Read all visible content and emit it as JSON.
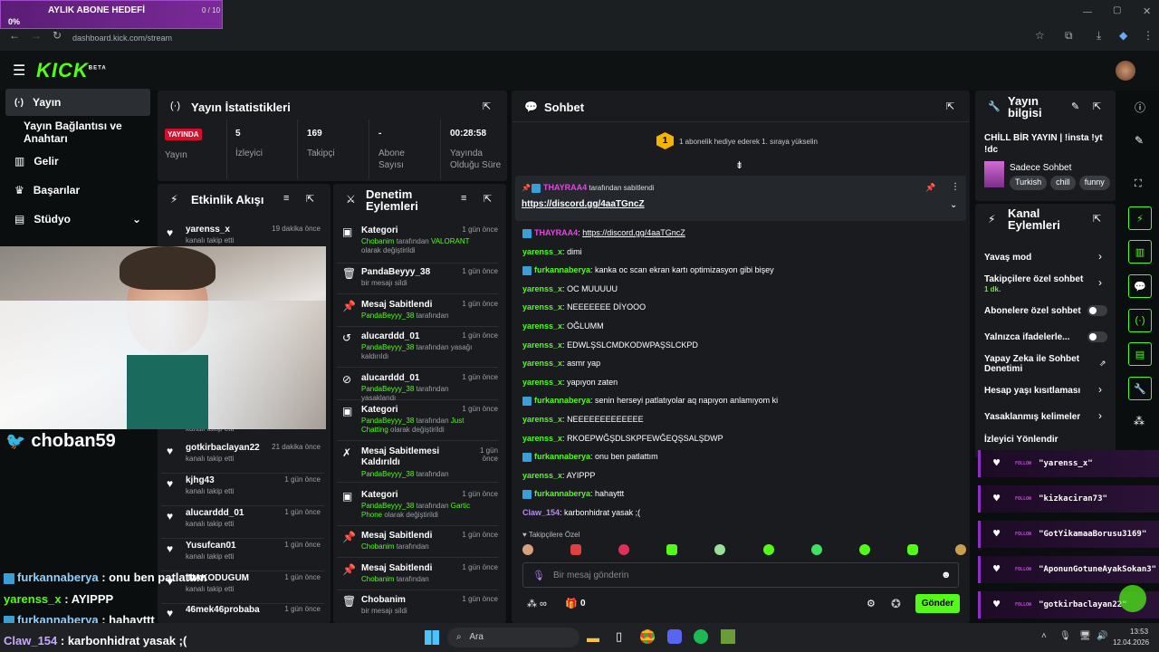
{
  "browser": {
    "url": "dashboard.kick.com/stream"
  },
  "goal": {
    "title": "AYLIK ABONE HEDEFİ",
    "count": "0 / 10",
    "percent": "0%"
  },
  "brand": {
    "logo": "KICK",
    "beta": "BETA"
  },
  "sidebar": {
    "items": [
      {
        "label": "Yayın",
        "icon": "broadcast-icon"
      },
      {
        "label": "Yayın Bağlantısı ve Anahtarı"
      },
      {
        "label": "Gelir",
        "icon": "chart-icon"
      },
      {
        "label": "Başarılar",
        "icon": "trophy-icon"
      },
      {
        "label": "Stüdyo",
        "icon": "studio-icon"
      }
    ]
  },
  "stats": {
    "title": "Yayın İstatistikleri",
    "live_badge": "YAYINDA",
    "live_label": "Yayın",
    "items": [
      {
        "value": "5",
        "label": "İzleyici"
      },
      {
        "value": "169",
        "label": "Takipçi"
      },
      {
        "value": "-",
        "label": "Abone Sayısı"
      },
      {
        "value": "00:28:58",
        "label": "Yayında Olduğu Süre"
      }
    ]
  },
  "activity": {
    "title": "Etkinlik Akışı",
    "items": [
      {
        "name": "yarenss_x",
        "time": "19 dakika önce",
        "sub": "kanalı takip etti"
      },
      {
        "name": "gotkirbaclayan22",
        "time": "21 dakika önce",
        "sub": "kanalı takip etti"
      },
      {
        "name": "kjhg43",
        "time": "1 gün önce",
        "sub": "kanalı takip etti"
      },
      {
        "name": "alucarddd_01",
        "time": "1 gün önce",
        "sub": "kanalı takip etti"
      },
      {
        "name": "Yusufcan01",
        "time": "1 gün önce",
        "sub": "kanalı takip etti"
      },
      {
        "name": "INAKODUGUM",
        "time": "1 gün önce",
        "sub": "kanalı takip etti"
      },
      {
        "name": "46mek46probaba",
        "time": "1 gün önce",
        "sub": ""
      }
    ],
    "partial_sub": "kanalı takip etti"
  },
  "mod": {
    "title": "Denetim Eylemleri",
    "items": [
      {
        "name": "Kategori",
        "time": "1 gün önce",
        "actor": "Chobanim",
        "mid": " tarafından ",
        "target": "VALORANT",
        "tail": " olarak değiştirildi"
      },
      {
        "name": "PandaBeyyy_38",
        "time": "1 gün önce",
        "actor": "",
        "mid": "bir mesajı sildi",
        "target": "",
        "tail": ""
      },
      {
        "name": "Mesaj Sabitlendi",
        "time": "1 gün önce",
        "actor": "PandaBeyyy_38",
        "mid": " tarafından",
        "target": "",
        "tail": ""
      },
      {
        "name": "alucarddd_01",
        "time": "1 gün önce",
        "actor": "PandaBeyyy_38",
        "mid": " tarafından yasağı kaldırıldı",
        "target": "",
        "tail": ""
      },
      {
        "name": "alucarddd_01",
        "time": "1 gün önce",
        "actor": "PandaBeyyy_38",
        "mid": " tarafından yasaklandı",
        "target": "",
        "tail": ""
      },
      {
        "name": "Kategori",
        "time": "1 gün önce",
        "actor": "PandaBeyyy_38",
        "mid": " tarafından ",
        "target": "Just Chatting",
        "tail": " olarak değiştirildi"
      },
      {
        "name": "Mesaj Sabitlemesi Kaldırıldı",
        "time": "1 gün önce",
        "actor": "PandaBeyyy_38",
        "mid": " tarafından",
        "target": "",
        "tail": ""
      },
      {
        "name": "Kategori",
        "time": "1 gün önce",
        "actor": "PandaBeyyy_38",
        "mid": " tarafından ",
        "target": "Gartic Phone",
        "tail": " olarak değiştirildi"
      },
      {
        "name": "Mesaj Sabitlendi",
        "time": "1 gün önce",
        "actor": "Chobanim",
        "mid": " tarafından",
        "target": "",
        "tail": ""
      },
      {
        "name": "Mesaj Sabitlendi",
        "time": "1 gün önce",
        "actor": "Chobanim",
        "mid": " tarafından",
        "target": "",
        "tail": ""
      },
      {
        "name": "Chobanim",
        "time": "1 gün önce",
        "actor": "",
        "mid": "bir mesajı sildi",
        "target": "",
        "tail": ""
      }
    ]
  },
  "chat": {
    "title": "Sohbet",
    "gift_num": "1",
    "gift_text": "1 abonelik hediye ederek 1. sıraya yükselin",
    "pinned_by": "THAYRAA4",
    "pinned_suffix": " tarafından sabitlendi",
    "pinned_link": "https://discord.gg/4aaTGncZ",
    "messages": [
      {
        "user": "THAYRAA4",
        "color": "#e04ae0",
        "badge": true,
        "text": "https://discord.gg/4aaTGncZ",
        "link": true
      },
      {
        "user": "yarenss_x",
        "color": "#53fc18",
        "badge": false,
        "text": "dimi"
      },
      {
        "user": "furkannaberya",
        "color": "#53fc18",
        "badge": true,
        "text": "kanka oc scan ekran kartı optimizasyon gibi bişey"
      },
      {
        "user": "yarenss_x",
        "color": "#53fc18",
        "badge": false,
        "text": "OC MUUUUU"
      },
      {
        "user": "yarenss_x",
        "color": "#53fc18",
        "badge": false,
        "text": "NEEEEEEE DİYOOO"
      },
      {
        "user": "yarenss_x",
        "color": "#53fc18",
        "badge": false,
        "text": "OĞLUMM"
      },
      {
        "user": "yarenss_x",
        "color": "#53fc18",
        "badge": false,
        "text": "EDWLŞSLCMDKODWPAŞSLCKPD"
      },
      {
        "user": "yarenss_x",
        "color": "#53fc18",
        "badge": false,
        "text": "asmr yap"
      },
      {
        "user": "yarenss_x",
        "color": "#53fc18",
        "badge": false,
        "text": "yapıyon zaten"
      },
      {
        "user": "furkannaberya",
        "color": "#53fc18",
        "badge": true,
        "text": "senin herseyi patlatıyolar aq napıyon anlamıyom ki"
      },
      {
        "user": "yarenss_x",
        "color": "#53fc18",
        "badge": false,
        "text": "NEEEEEEEEEEEEE"
      },
      {
        "user": "yarenss_x",
        "color": "#53fc18",
        "badge": false,
        "text": "RKOEPWĞŞDLSKPFEWĞEQŞSALŞDWP"
      },
      {
        "user": "furkannaberya",
        "color": "#53fc18",
        "badge": true,
        "text": "onu ben patlattım"
      },
      {
        "user": "yarenss_x",
        "color": "#53fc18",
        "badge": false,
        "text": "AYIPPP"
      },
      {
        "user": "furkannaberya",
        "color": "#53fc18",
        "badge": true,
        "text": "hahayttt"
      },
      {
        "user": "Claw_154",
        "color": "#b48cf0",
        "badge": false,
        "text": "karbonhidrat yasak ;("
      }
    ],
    "followers_only": "Takipçilere Özel",
    "placeholder": "Bir mesaj gönderin",
    "points": "0",
    "send": "Gönder"
  },
  "stream_info": {
    "title": "Yayın bilgisi",
    "stream_title": "CHİLL BİR YAYIN | !insta !yt !dc",
    "category": "Sadece Sohbet",
    "tags": [
      "Turkish",
      "chill",
      "funny"
    ]
  },
  "channel_actions": {
    "title": "Kanal Eylemleri",
    "items": [
      {
        "label": "Yavaş mod",
        "sub": "",
        "kind": "chevron"
      },
      {
        "label": "Takipçilere özel sohbet",
        "sub": "1 dk.",
        "kind": "chevron"
      },
      {
        "label": "Abonelere özel sohbet",
        "sub": "",
        "kind": "toggle"
      },
      {
        "label": "Yalnızca ifadelerle...",
        "sub": "",
        "kind": "toggle"
      },
      {
        "label": "Yapay Zeka ile Sohbet Denetimi",
        "sub": "",
        "kind": "ext"
      },
      {
        "label": "Hesap yaşı kısıtlaması",
        "sub": "",
        "kind": "chevron"
      },
      {
        "label": "Yasaklanmış kelimeler",
        "sub": "",
        "kind": "chevron"
      },
      {
        "label": "İzleyici Yönlendir",
        "sub": "",
        "kind": ""
      }
    ]
  },
  "follow_overlay": {
    "tag": "FOLLOW",
    "names": [
      "\"yarenss_x\"",
      "\"kizkaciran73\"",
      "\"GotYikamaaBorusu3169\"",
      "\"AponunGotuneAyakSokan3\"",
      "\"gotkirbaclayan22\""
    ]
  },
  "overlay": {
    "handle": "choban59",
    "chat": [
      {
        "user": "furkannaberya",
        "color": "#8fd0ff",
        "text": " : onu ben patlattım"
      },
      {
        "user": "yarenss_x",
        "color": "#53fc18",
        "text": " : AYIPPP"
      },
      {
        "user": "furkannaberya",
        "color": "#8fd0ff",
        "text": " : hahayttt"
      },
      {
        "user": "Claw_154",
        "color": "#c8a8ff",
        "text": " : karbonhidrat yasak ;("
      }
    ]
  },
  "taskbar": {
    "search": "Ara",
    "time": "13:53",
    "date": "12.04.2026"
  }
}
